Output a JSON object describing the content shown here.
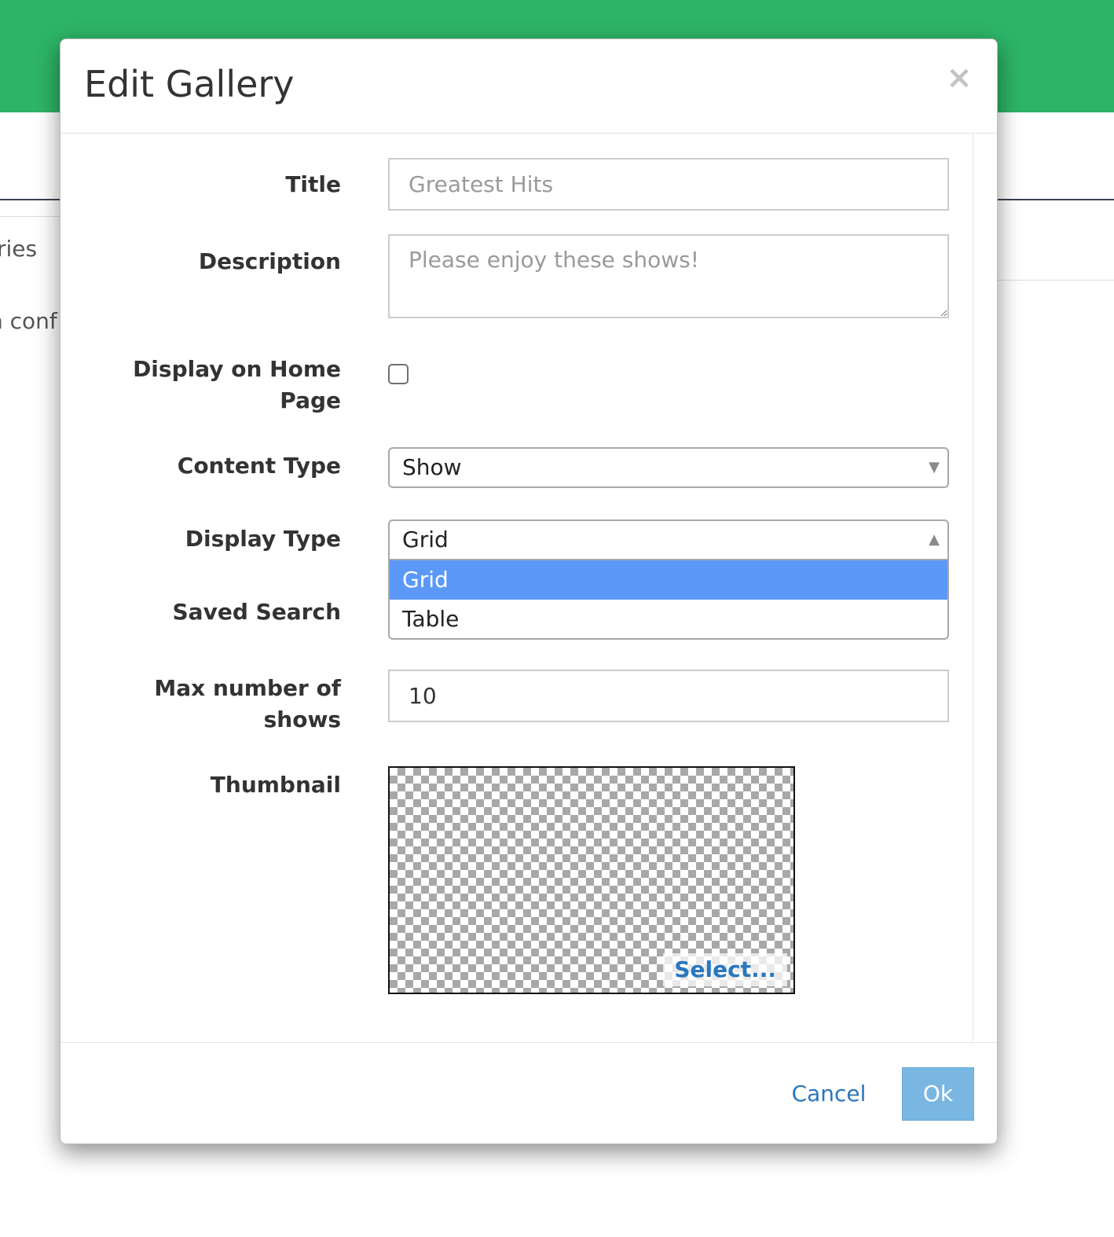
{
  "background": {
    "fragment_1": "ries",
    "fragment_2": "n conf"
  },
  "modal": {
    "title": "Edit Gallery",
    "close_glyph": "×",
    "form": {
      "title": {
        "label": "Title",
        "placeholder": "Greatest Hits"
      },
      "description": {
        "label": "Description",
        "placeholder": "Please enjoy these shows!"
      },
      "display_on_home_page": {
        "label_line1": "Display on Home",
        "label_line2": "Page",
        "checked": false
      },
      "content_type": {
        "label": "Content Type",
        "value": "Show"
      },
      "display_type": {
        "label": "Display Type",
        "value": "Grid",
        "options": [
          "Grid",
          "Table"
        ],
        "highlighted": "Grid"
      },
      "saved_search": {
        "label": "Saved Search"
      },
      "max_number": {
        "label_line1": "Max number of",
        "label_line2": "shows",
        "value": "10"
      },
      "thumbnail": {
        "label": "Thumbnail",
        "select_label": "Select..."
      }
    },
    "footer": {
      "cancel_label": "Cancel",
      "ok_label": "Ok"
    }
  },
  "icons": {
    "close": "close-icon",
    "select_down": "chevron-down-icon",
    "select_up": "chevron-up-icon"
  },
  "colors": {
    "header_green": "#2db467",
    "link_blue": "#2a77bd",
    "ok_button": "#7ab6e2",
    "option_highlight": "#5b98f7"
  }
}
